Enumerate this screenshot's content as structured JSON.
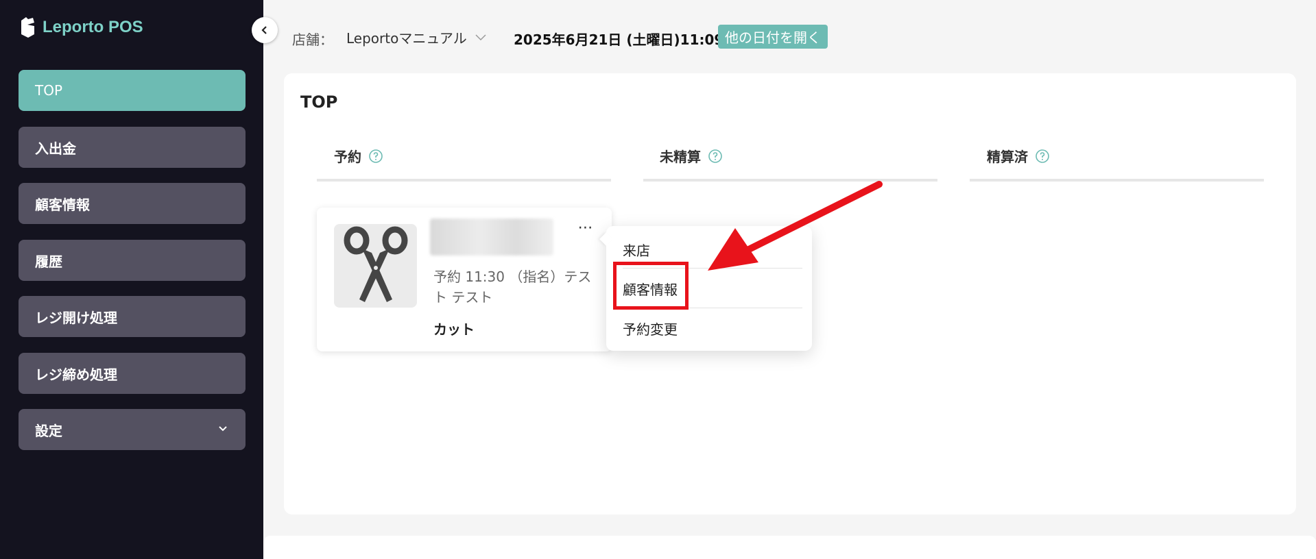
{
  "app": {
    "name": "Leporto POS"
  },
  "sidebar": {
    "items": [
      {
        "label": "TOP",
        "active": true
      },
      {
        "label": "入出金"
      },
      {
        "label": "顧客情報"
      },
      {
        "label": "履歴"
      },
      {
        "label": "レジ開け処理"
      },
      {
        "label": "レジ締め処理"
      },
      {
        "label": "設定",
        "has_submenu": true
      }
    ]
  },
  "header": {
    "store_label": "店舗：",
    "store_value": "Leportoマニュアル",
    "date": "2025年6月21日 (土曜日)11:09",
    "other_date_button": "他の日付を開く"
  },
  "main": {
    "title": "TOP",
    "columns": [
      {
        "label": "予約"
      },
      {
        "label": "未精算"
      },
      {
        "label": "精算済"
      }
    ]
  },
  "reservation_card": {
    "more_label": "⋯",
    "detail": "予約 11:30 （指名）テスト テスト",
    "menu": "カット",
    "icon": "scissors-icon"
  },
  "dropdown": {
    "items": [
      "来店",
      "顧客情報",
      "予約変更"
    ]
  },
  "colors": {
    "sidebar_bg": "#14131f",
    "accent": "#6dbbb3",
    "nav_item_bg": "#545161",
    "highlight": "#e8131b"
  }
}
